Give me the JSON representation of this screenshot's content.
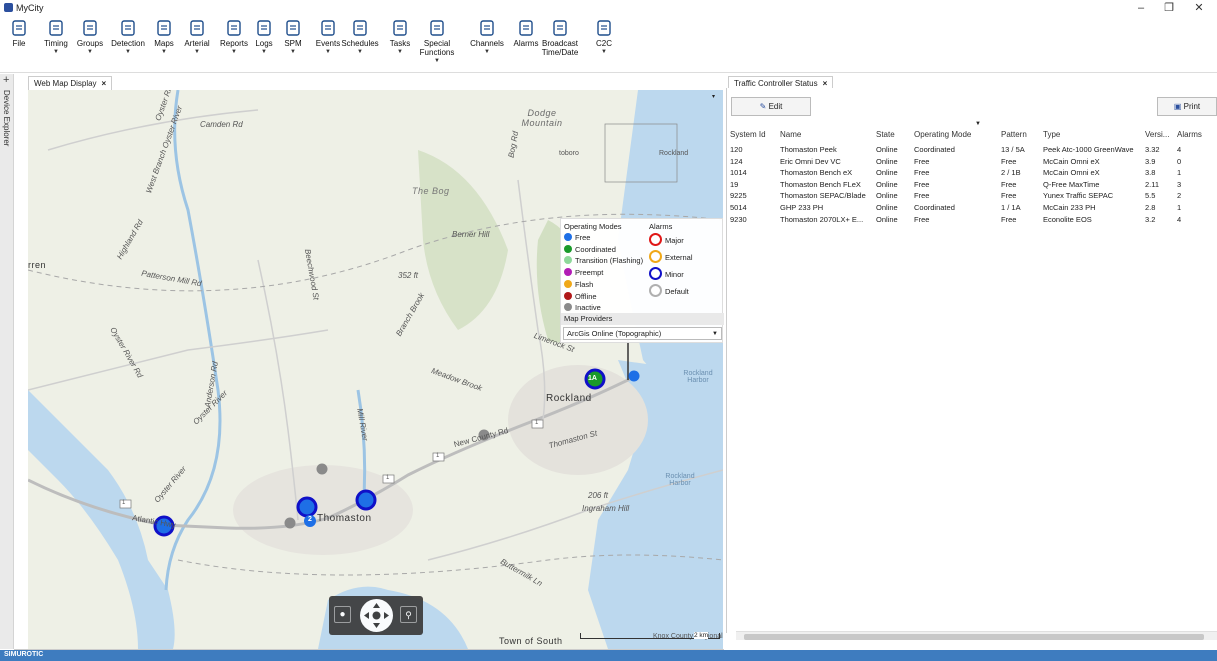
{
  "window": {
    "title": "MyCity",
    "minimize": "–",
    "restore": "❐",
    "close": "✕"
  },
  "toolbar": [
    {
      "label": "File",
      "icon": "file-icon",
      "caret": false
    },
    {
      "label": "Timing",
      "icon": "timing-icon",
      "caret": true
    },
    {
      "label": "Groups",
      "icon": "groups-icon",
      "caret": true
    },
    {
      "label": "Detection",
      "icon": "detection-icon",
      "caret": true
    },
    {
      "label": "Maps",
      "icon": "maps-icon",
      "caret": true
    },
    {
      "label": "Arterial",
      "icon": "arterial-icon",
      "caret": true
    },
    {
      "label": "Reports",
      "icon": "reports-icon",
      "caret": true
    },
    {
      "label": "Logs",
      "icon": "logs-icon",
      "caret": true
    },
    {
      "label": "SPM",
      "icon": "spm-icon",
      "caret": true
    },
    {
      "label": "Events",
      "icon": "events-icon",
      "caret": true
    },
    {
      "label": "Schedules",
      "icon": "schedules-icon",
      "caret": true
    },
    {
      "label": "Tasks",
      "icon": "tasks-icon",
      "caret": true
    },
    {
      "label": "Special\nFunctions",
      "icon": "special-functions-icon",
      "caret": true
    },
    {
      "label": "Channels",
      "icon": "channels-icon",
      "caret": true
    },
    {
      "label": "Alarms",
      "icon": "alarms-icon",
      "caret": false
    },
    {
      "label": "Broadcast\nTime/Date",
      "icon": "broadcast-icon",
      "caret": false
    },
    {
      "label": "C2C",
      "icon": "c2c-icon",
      "caret": true
    }
  ],
  "side": {
    "plus": "+",
    "label": "Device Explorer"
  },
  "tabs": {
    "map_tab": "Web Map Display",
    "status_tab": "Traffic Controller Status",
    "close": "×"
  },
  "map": {
    "labels": {
      "camden": "Camden Rd",
      "west_branch": "West Branch Oyster River",
      "oyster_top": "Oyster River",
      "dodge": "Dodge Mountain",
      "toboro": "toboro",
      "rockland_top": "Rockland",
      "bog": "The Bog",
      "bog_rd": "Bog Rd",
      "berner": "Berner Hill",
      "highland": "Highland Rd",
      "arren": "rren",
      "patterson": "Patterson Mill Rd",
      "beechwood": "Beechwood St",
      "elev352": "352 ft",
      "branch_brook": "Branch Brook",
      "limerock": "Limerock St",
      "oyster_rd": "Oyster River Rd",
      "anderson": "Anderson Rd",
      "oyster_river2": "Oyster River",
      "meadow": "Meadow Brook",
      "mill_river": "Mill River",
      "new_county": "New County Rd",
      "thomaston_st": "Thomaston St",
      "oyster_river3": "Oyster River",
      "atlantic_hwy": "Atlantic Hwy",
      "thomaston": "Thomaston",
      "rockland": "Rockland",
      "rockland_harbor1": "Rockland Harbor",
      "rockland_harbor2": "Rockland Harbor",
      "elev206": "206 ft",
      "ingraham": "Ingraham Hill",
      "buttermilk": "Buttermilk Ln",
      "town_south": "Town of South",
      "knox": "Knox County Regional",
      "route1a": "1",
      "route1b": "1",
      "route1c": "1",
      "route1d": "1"
    },
    "markers": [
      {
        "label": "1A"
      },
      {
        "label": "2"
      }
    ],
    "scale": "2 km"
  },
  "legend": {
    "modes_header": "Operating Modes",
    "alarms_header": "Alarms",
    "modes": [
      {
        "label": "Free",
        "color": "#1e6fe6"
      },
      {
        "label": "Coordinated",
        "color": "#1a9a2a"
      },
      {
        "label": "Transition (Flashing)",
        "color": "#8ed89a"
      },
      {
        "label": "Preempt",
        "color": "#b21cb5"
      },
      {
        "label": "Flash",
        "color": "#f0a818"
      },
      {
        "label": "Offline",
        "color": "#b01818"
      },
      {
        "label": "Inactive",
        "color": "#8a8a8a"
      }
    ],
    "alarms": [
      {
        "label": "Major",
        "color": "#e01818"
      },
      {
        "label": "External",
        "color": "#f0a818"
      },
      {
        "label": "Minor",
        "color": "#1010c8"
      },
      {
        "label": "Default",
        "color": "#b0b0b0"
      }
    ],
    "providers_header": "Map Providers",
    "provider_selected": "ArcGis Online (Topographic)"
  },
  "status_panel": {
    "edit_label": "Edit",
    "print_label": "Print",
    "columns": [
      "System Id",
      "Name",
      "State",
      "Operating Mode",
      "Pattern",
      "Type",
      "Versi...",
      "Alarms"
    ],
    "rows": [
      [
        "120",
        "Thomaston Peek",
        "Online",
        "Coordinated",
        "13 / 5A",
        "Peek Atc-1000 GreenWave",
        "3.32",
        "4"
      ],
      [
        "124",
        "Eric Omni Dev VC",
        "Online",
        "Free",
        "Free",
        "McCain Omni eX",
        "3.9",
        "0"
      ],
      [
        "1014",
        "Thomaston Bench eX",
        "Online",
        "Free",
        "2 / 1B",
        "McCain Omni eX",
        "3.8",
        "1"
      ],
      [
        "19",
        "Thomaston Bench FLeX",
        "Online",
        "Free",
        "Free",
        "Q-Free MaxTime",
        "2.11",
        "3"
      ],
      [
        "9225",
        "Thomaston SEPAC/Blade",
        "Online",
        "Free",
        "Free",
        "Yunex Traffic SEPAC",
        "5.5",
        "2"
      ],
      [
        "5014",
        "GHP 233 PH",
        "Online",
        "Coordinated",
        "1 / 1A",
        "McCain 233 PH",
        "2.8",
        "1"
      ],
      [
        "9230",
        "Thomaston 2070LX+ E...",
        "Online",
        "Free",
        "Free",
        "Econolite EOS",
        "3.2",
        "4"
      ]
    ]
  },
  "statusbar": {
    "logo": "SIMUROTIC"
  }
}
